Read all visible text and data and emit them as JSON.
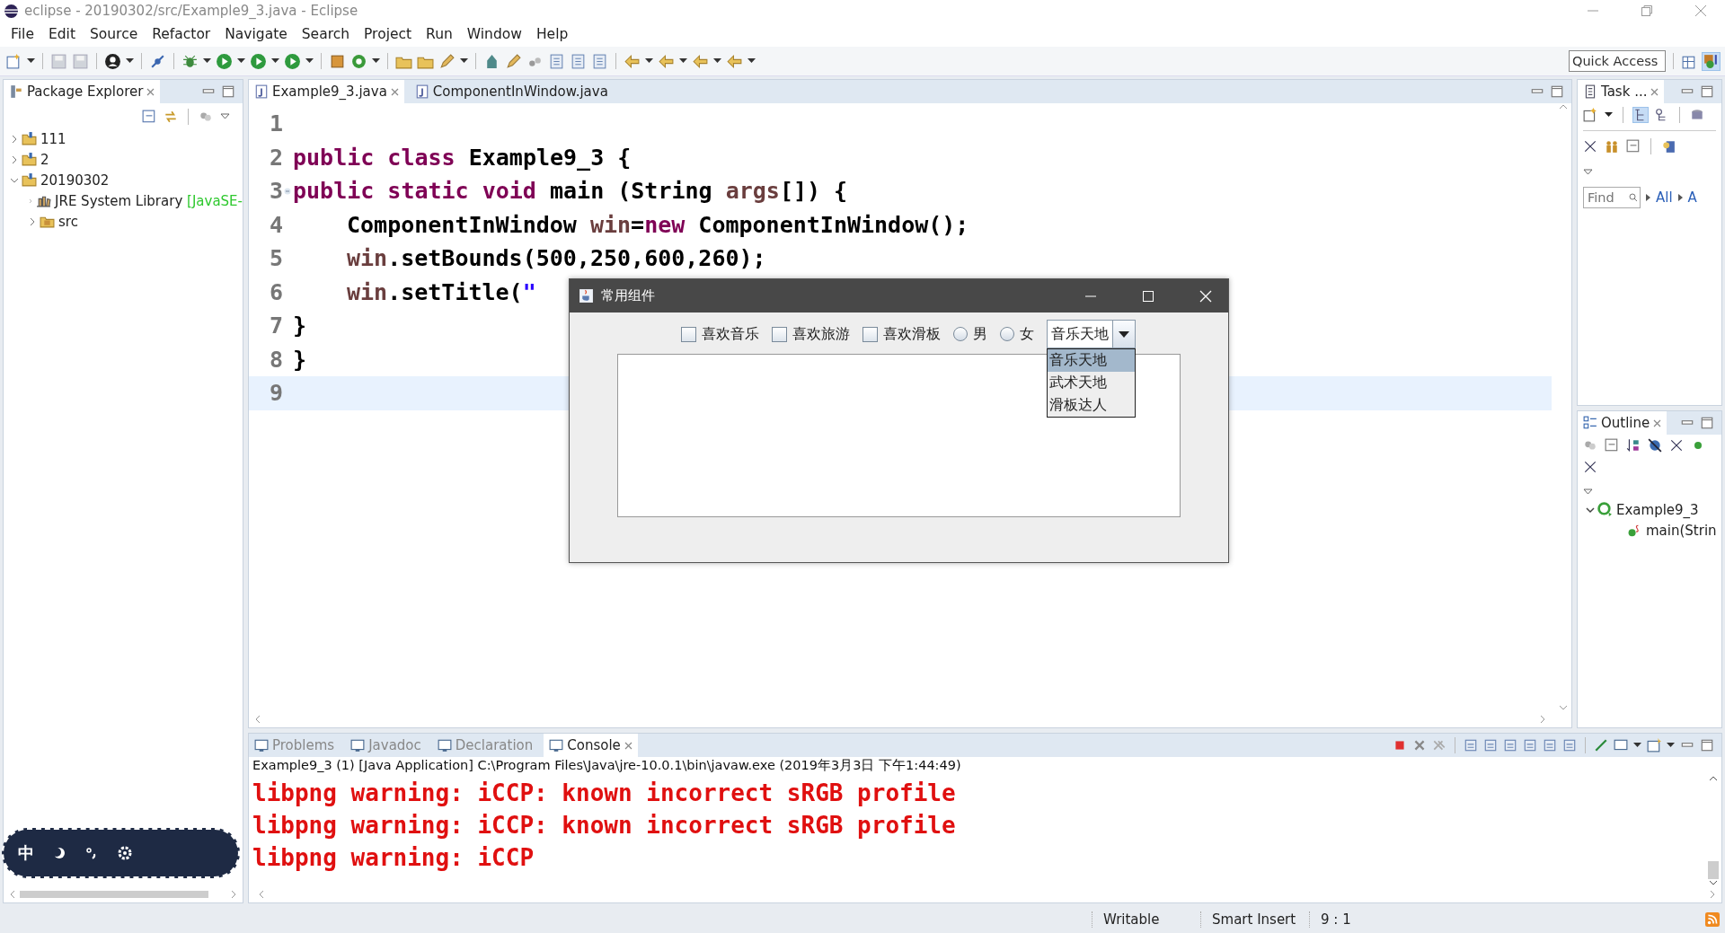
{
  "window": {
    "title": "eclipse - 20190302/src/Example9_3.java - Eclipse"
  },
  "menu": [
    "File",
    "Edit",
    "Source",
    "Refactor",
    "Navigate",
    "Search",
    "Project",
    "Run",
    "Window",
    "Help"
  ],
  "quick_access": {
    "placeholder": "Quick Access"
  },
  "package_explorer": {
    "title": "Package Explorer",
    "tree": [
      {
        "label": "111",
        "expanded": false
      },
      {
        "label": "2",
        "expanded": false
      },
      {
        "label": "20190302",
        "expanded": true,
        "children": [
          {
            "label": "JRE System Library ",
            "suffix": "[JavaSE-",
            "kind": "library",
            "expanded": false
          },
          {
            "label": "src",
            "kind": "package",
            "expanded": false
          }
        ]
      }
    ]
  },
  "editor": {
    "tabs": [
      {
        "label": "Example9_3.java",
        "selected": true
      },
      {
        "label": "ComponentInWindow.java",
        "selected": false
      }
    ],
    "lines": [
      {
        "number": "1",
        "current": false,
        "fold": false
      },
      {
        "number": "2",
        "current": false,
        "fold": false,
        "indent": false,
        "tokens": [
          {
            "text": "public class",
            "kind": "keyword"
          },
          {
            "text": " Example9_3 {",
            "kind": "plain"
          }
        ]
      },
      {
        "number": "3",
        "current": false,
        "fold": true,
        "indent": false,
        "tokens": [
          {
            "text": "public static void",
            "kind": "keyword"
          },
          {
            "text": " main (String ",
            "kind": "plain"
          },
          {
            "text": "args",
            "kind": "variable"
          },
          {
            "text": "[]) {",
            "kind": "plain"
          }
        ]
      },
      {
        "number": "4",
        "current": false,
        "fold": false,
        "indent": true,
        "tokens": [
          {
            "text": "ComponentInWindow ",
            "kind": "plain"
          },
          {
            "text": "win",
            "kind": "variable"
          },
          {
            "text": "=",
            "kind": "plain"
          },
          {
            "text": "new",
            "kind": "keyword"
          },
          {
            "text": " ComponentInWindow();",
            "kind": "plain"
          }
        ]
      },
      {
        "number": "5",
        "current": false,
        "fold": false,
        "indent": true,
        "tokens": [
          {
            "text": "win",
            "kind": "variable"
          },
          {
            "text": ".setBounds(500,250,600,260);",
            "kind": "plain"
          }
        ]
      },
      {
        "number": "6",
        "current": false,
        "fold": false,
        "indent": true,
        "tokens": [
          {
            "text": "win",
            "kind": "variable"
          },
          {
            "text": ".setTitle(",
            "kind": "plain"
          },
          {
            "text": "\"",
            "kind": "string"
          }
        ]
      },
      {
        "number": "7",
        "current": false,
        "fold": false,
        "indent": false,
        "tokens": [
          {
            "text": "}",
            "kind": "plain"
          }
        ]
      },
      {
        "number": "8",
        "current": false,
        "fold": false,
        "indent": false,
        "tokens": [
          {
            "text": "}",
            "kind": "plain"
          }
        ]
      },
      {
        "number": "9",
        "current": true,
        "fold": false
      }
    ]
  },
  "dialog": {
    "title": "常用组件",
    "checkboxes": [
      {
        "label": "喜欢音乐",
        "checked": false
      },
      {
        "label": "喜欢旅游",
        "checked": false
      },
      {
        "label": "喜欢滑板",
        "checked": false
      }
    ],
    "radios": [
      {
        "label": "男",
        "selected": false
      },
      {
        "label": "女",
        "selected": false
      }
    ],
    "combo": {
      "value": "音乐天地",
      "options": [
        {
          "label": "音乐天地",
          "selected": true
        },
        {
          "label": "武术天地",
          "selected": false
        },
        {
          "label": "滑板达人",
          "selected": false
        }
      ]
    }
  },
  "task_list": {
    "title": "Task ...",
    "find": {
      "placeholder": "Find"
    },
    "filters": [
      "All",
      "A"
    ]
  },
  "outline": {
    "title": "Outline",
    "tree": [
      {
        "label": "Example9_3",
        "expanded": true,
        "children": [
          {
            "label": "main(Strin"
          }
        ]
      }
    ]
  },
  "bottom_panel": {
    "tabs": [
      {
        "label": "Problems",
        "selected": false
      },
      {
        "label": "Javadoc",
        "selected": false
      },
      {
        "label": "Declaration",
        "selected": false
      },
      {
        "label": "Console",
        "selected": true
      }
    ],
    "console_header": "Example9_3 (1) [Java Application] C:\\Program Files\\Java\\jre-10.0.1\\bin\\javaw.exe (2019年3月3日 下午1:44:49)",
    "console_lines": [
      "libpng warning: iCCP: known incorrect sRGB profile",
      "libpng warning: iCCP: known incorrect sRGB profile",
      "libpng warning: iCCP"
    ]
  },
  "ime": {
    "mode": "中"
  },
  "status_bar": [
    "Writable",
    "Smart Insert",
    "9 : 1"
  ]
}
